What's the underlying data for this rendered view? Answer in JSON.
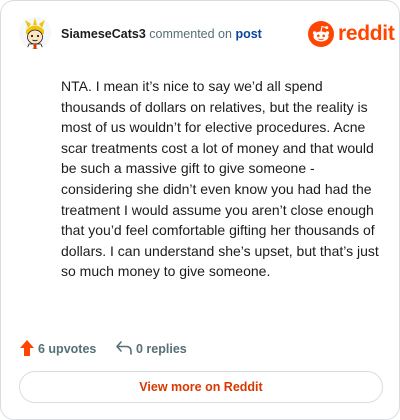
{
  "comment": {
    "username": "SiameseCats3",
    "commented_on_text": "commented on",
    "post_link_label": "post",
    "body": "NTA. I mean it’s nice to say we’d all spend thousands of dollars on relatives, but the reality is most of us wouldn’t for elective procedures. Acne scar treatments cost a lot of money and that would be such a massive gift to give someone - considering she didn’t even know you had had the treatment I would assume you aren’t close enough that you’d feel comfortable gifting her thousands of dollars. I can understand she’s upset, but that’s just so much money to give someone."
  },
  "brand": {
    "name": "reddit",
    "icon": "reddit-snoo-icon",
    "color": "#ff4500"
  },
  "actions": {
    "upvotes_label": "6 upvotes",
    "upvote_icon": "upvote-arrow-icon",
    "upvote_color": "#ff4500",
    "replies_label": "0 replies",
    "reply_icon": "reply-arrow-icon"
  },
  "footer": {
    "view_more_label": "View more on Reddit",
    "view_more_color": "#d93900"
  }
}
